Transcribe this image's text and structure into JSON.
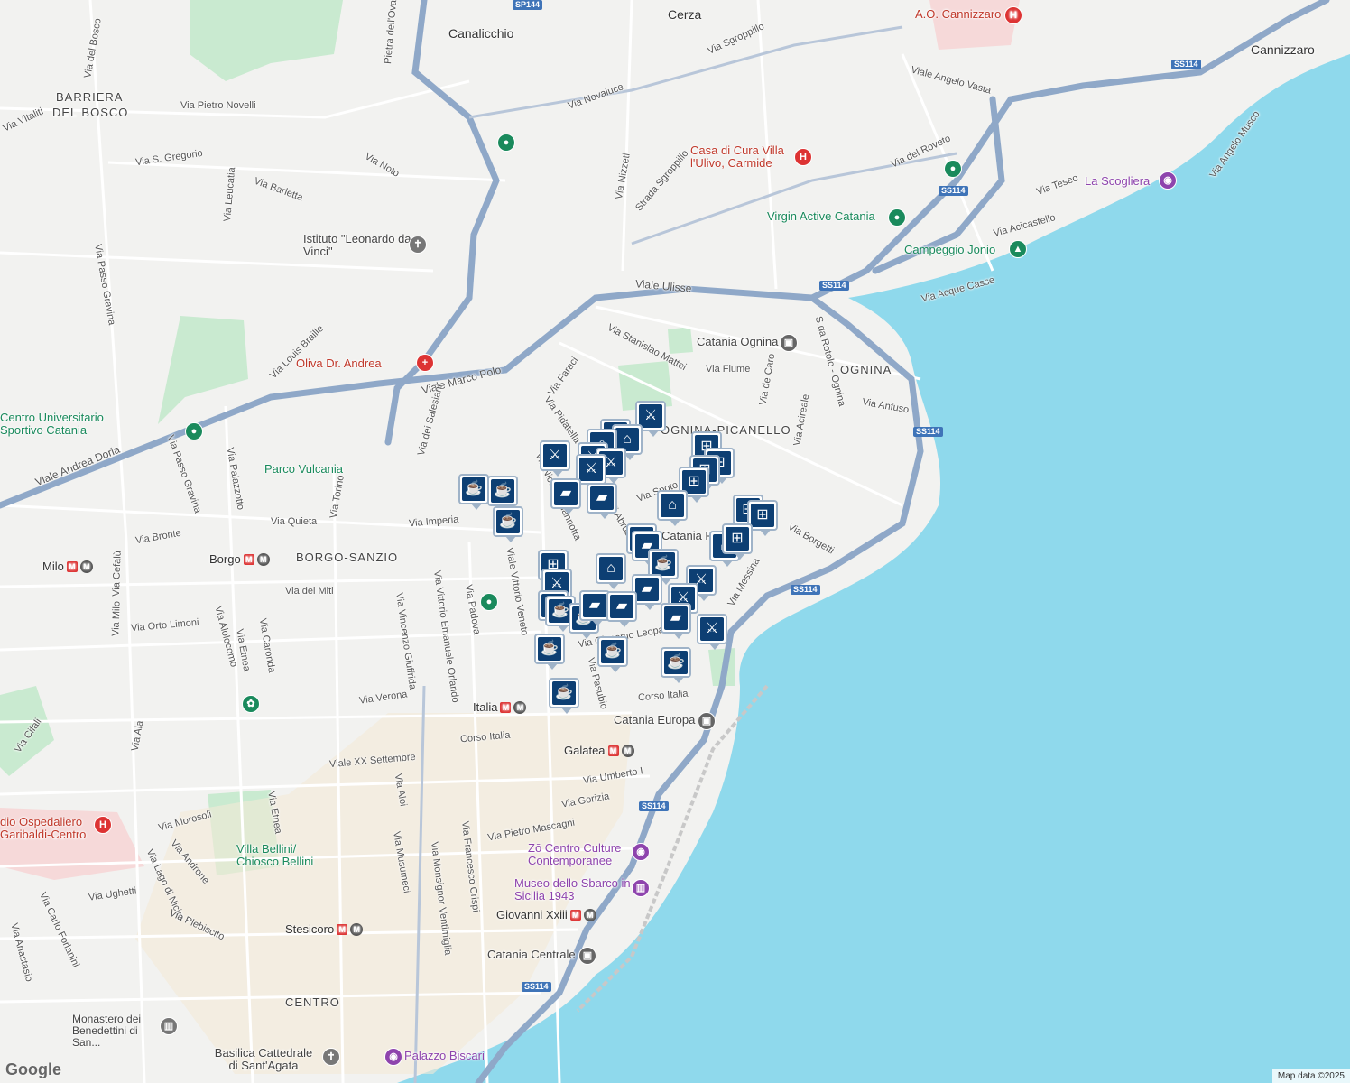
{
  "places": [
    "Canalicchio",
    "Cerza",
    "Cannizzaro",
    "BARRIERA",
    "DEL BOSCO",
    "BORGO-SANZIO",
    "OGNINA",
    "OGNINA-PICANELLO",
    "CENTRO"
  ],
  "streets": [
    "Via Pietro Novelli",
    "Via Vitaliti",
    "Via del Bosco",
    "Via S. Gregorio",
    "Via Leucatia",
    "Via Noto",
    "Via Barletta",
    "Via Passo Gravina",
    "Via Louis Braille",
    "Viale Marco Polo",
    "Viale Andrea Doria",
    "Via Passo Gravina",
    "Via Palazzotto",
    "Via dei Salesiani",
    "Via Torino",
    "Via Quieta",
    "Via Imperia",
    "Via Bronte",
    "Via Cefalù",
    "Via Milo",
    "Via Orto Limoni",
    "Via Aiolocomo",
    "Via Etnea",
    "Via Caronda",
    "Via dei Miti",
    "Via Vittorio Emanuele Orlando",
    "Via Vincenzo Giuffrida",
    "Via Padova",
    "Viale Vittorio Veneto",
    "Via Verona",
    "Via Ala",
    "Via Cifali",
    "Viale XX Settembre",
    "Via Aloi",
    "Via Etnea",
    "Via Morosoli",
    "Via Androne",
    "Via Lago di Nicito",
    "Via Ughetti",
    "Via Carlo Forlanini",
    "Via Anastasio",
    "Via Plebiscito",
    "Via Musumeci",
    "Via Monsignor Ventimiglia",
    "Via Francesco Crispi",
    "Corso Italia",
    "Corso Italia",
    "Via Umberto I",
    "Via Gorizia",
    "Via Pietro Mascagni",
    "Via Pasubio",
    "Via Novaluce",
    "Via Sgroppillo",
    "Strada Sgroppillo",
    "Via Nizzeti",
    "Viale Ulisse",
    "Via Stanislao Mattei",
    "Via Faraci",
    "Via Fiume",
    "Via de Caro",
    "Viale Angelo Vasta",
    "Via del Roveto",
    "Via Teseo",
    "Via Acicastello",
    "Via Angelo Musco",
    "Via Acque Casse",
    "Via Anfuso",
    "Via Borgetti",
    "Via Spoto",
    "Via Messina",
    "Via Acireale",
    "Via Pidatella",
    "Via Niccolò Giannotta",
    "Via degli Abruzzi",
    "Via Giacomo Leopardi",
    "S.da Rotolo - Ognina",
    "Pietra dell'Ova"
  ],
  "pois": {
    "hospital_cannizzaro": "A.O. Cannizzaro",
    "casa_cura": "Casa di Cura Villa l'Ulivo, Carmide",
    "istituto": "Istituto \"Leonardo da Vinci\"",
    "oliva": "Oliva Dr. Andrea",
    "cus": "Centro Universitario Sportivo Catania",
    "parco": "Parco Vulcania",
    "virgin": "Virgin Active Catania",
    "campeggio": "Campeggio Jonio",
    "scogliera": "La Scogliera",
    "ognina_station": "Catania Ognina",
    "europa_station": "Catania Europa",
    "zo": "Zō Centro Culture Contemporanee",
    "museo": "Museo dello Sbarco in Sicilia 1943",
    "centrale": "Catania Centrale",
    "ospedale_garibaldi": "dio Ospedaliero Garibaldi-Centro",
    "villa_bellini": "Villa Bellini/ Chiosco Bellini",
    "monastero": "Monastero dei Benedettini di San...",
    "basilica": "Basilica Cattedrale di Sant'Agata",
    "palazzo": "Palazzo Biscari",
    "catania_pica": "Catania Pica"
  },
  "metro": [
    "Milo",
    "Borgo",
    "Italia",
    "Galatea",
    "Stesicoro",
    "Giovanni Xxiii"
  ],
  "shields": [
    "SP144",
    "SS114",
    "SS114",
    "SS114",
    "SS114",
    "SS114",
    "SS114"
  ],
  "markers": {
    "icons": [
      "cafe-icon",
      "restaurant-icon",
      "shopping-bag-icon",
      "grocery-cart-icon",
      "school-icon"
    ]
  },
  "attribution": "Map data ©2025",
  "logo": "Google",
  "colors": {
    "water": "#8fd9ec",
    "highway": "#8fa8c8",
    "marker": "#0d3f73",
    "land": "#f2f2f0",
    "park": "#c9ead0"
  }
}
